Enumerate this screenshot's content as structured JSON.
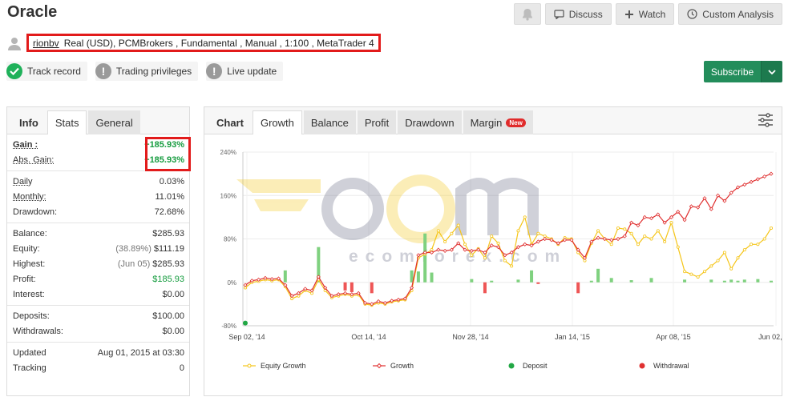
{
  "title": "Oracle",
  "actions": {
    "discuss": "Discuss",
    "watch": "Watch",
    "custom": "Custom Analysis"
  },
  "account": {
    "username": "rionbv",
    "details": "Real (USD), PCMBrokers , Fundamental , Manual , 1:100 , MetaTrader 4"
  },
  "badges": [
    "Track record",
    "Trading privileges",
    "Live update"
  ],
  "subscribe": "Subscribe",
  "left_tabs": [
    "Info",
    "Stats",
    "General"
  ],
  "stats": {
    "gain_label": "Gain :",
    "gain": "+185.93%",
    "abs_gain_label": "Abs. Gain:",
    "abs_gain": "+185.93%",
    "daily_label": "Daily",
    "daily": "0.03%",
    "monthly_label": "Monthly:",
    "monthly": "11.01%",
    "drawdown_label": "Drawdown:",
    "drawdown": "72.68%",
    "balance_label": "Balance:",
    "balance": "$285.93",
    "equity_label": "Equity:",
    "equity_pct": "(38.89%)",
    "equity": "$111.19",
    "highest_label": "Highest:",
    "highest_date": "(Jun 05)",
    "highest": "$285.93",
    "profit_label": "Profit:",
    "profit": "$185.93",
    "interest_label": "Interest:",
    "interest": "$0.00",
    "deposits_label": "Deposits:",
    "deposits": "$100.00",
    "withdrawals_label": "Withdrawals:",
    "withdrawals": "$0.00",
    "updated_label": "Updated",
    "updated": "Aug 01, 2015 at 03:30",
    "tracking_label": "Tracking",
    "tracking": "0"
  },
  "chart_tabs": [
    "Chart",
    "Growth",
    "Balance",
    "Profit",
    "Drawdown",
    "Margin"
  ],
  "new_badge": "New",
  "watermark": {
    "text": "ecomforex.com"
  },
  "colors": {
    "equity": "#f5c518",
    "growth": "#e03030",
    "deposit": "#22a845",
    "withdrawal": "#e03030",
    "bar_pos": "#7fd17f",
    "bar_neg": "#ee5555"
  },
  "chart_data": {
    "type": "line",
    "y_ticks": [
      "240%",
      "160%",
      "80%",
      "0%",
      "-80%"
    ],
    "ylim": [
      -80,
      240
    ],
    "x_ticks": [
      "Sep 02, '14",
      "Oct 14, '14",
      "Nov 28, '14",
      "Jan 14, '15",
      "Apr 08, '15",
      "Jun 02, '15"
    ],
    "legend": [
      "Equity Growth",
      "Growth",
      "Deposit",
      "Withdrawal"
    ],
    "series": [
      {
        "name": "Growth",
        "values": [
          -5,
          3,
          5,
          8,
          6,
          7,
          -5,
          -25,
          -20,
          -12,
          -15,
          10,
          -10,
          -25,
          -22,
          -20,
          -22,
          -20,
          -38,
          -40,
          -35,
          -38,
          -34,
          -32,
          -30,
          -10,
          50,
          55,
          55,
          60,
          58,
          60,
          72,
          60,
          58,
          60,
          55,
          68,
          65,
          50,
          55,
          65,
          70,
          68,
          75,
          80,
          78,
          72,
          78,
          78,
          60,
          45,
          75,
          82,
          80,
          78,
          80,
          85,
          110,
          105,
          120,
          118,
          125,
          110,
          120,
          130,
          115,
          140,
          138,
          155,
          135,
          160,
          150,
          165,
          175,
          180,
          185,
          190,
          195,
          200
        ]
      },
      {
        "name": "Equity Growth",
        "values": [
          -10,
          0,
          2,
          5,
          3,
          5,
          -8,
          -30,
          -25,
          -15,
          -20,
          5,
          -15,
          -28,
          -25,
          -22,
          -25,
          -23,
          -40,
          -42,
          -38,
          -40,
          -36,
          -34,
          -32,
          -15,
          45,
          52,
          60,
          95,
          75,
          90,
          105,
          70,
          50,
          62,
          45,
          85,
          72,
          40,
          30,
          95,
          120,
          70,
          90,
          85,
          80,
          70,
          82,
          80,
          55,
          40,
          72,
          95,
          80,
          70,
          100,
          98,
          90,
          70,
          85,
          80,
          95,
          75,
          110,
          65,
          20,
          15,
          10,
          20,
          30,
          40,
          55,
          25,
          45,
          60,
          70,
          70,
          80,
          100
        ]
      },
      {
        "name": "Deposit",
        "points": [
          {
            "x": 0,
            "y": -75
          }
        ]
      }
    ],
    "bars": [
      0,
      0,
      0,
      0,
      0,
      0,
      22,
      0,
      0,
      0,
      0,
      65,
      0,
      0,
      0,
      -15,
      -18,
      0,
      0,
      -20,
      0,
      0,
      0,
      0,
      0,
      22,
      20,
      90,
      18,
      0,
      0,
      0,
      0,
      0,
      6,
      0,
      -20,
      3,
      0,
      0,
      0,
      5,
      0,
      22,
      -3,
      0,
      0,
      0,
      0,
      0,
      -20,
      0,
      3,
      25,
      0,
      8,
      0,
      0,
      4,
      0,
      0,
      8,
      0,
      0,
      0,
      0,
      5,
      0,
      0,
      0,
      5,
      0,
      3,
      5,
      3,
      5,
      0,
      6,
      0,
      3
    ]
  }
}
